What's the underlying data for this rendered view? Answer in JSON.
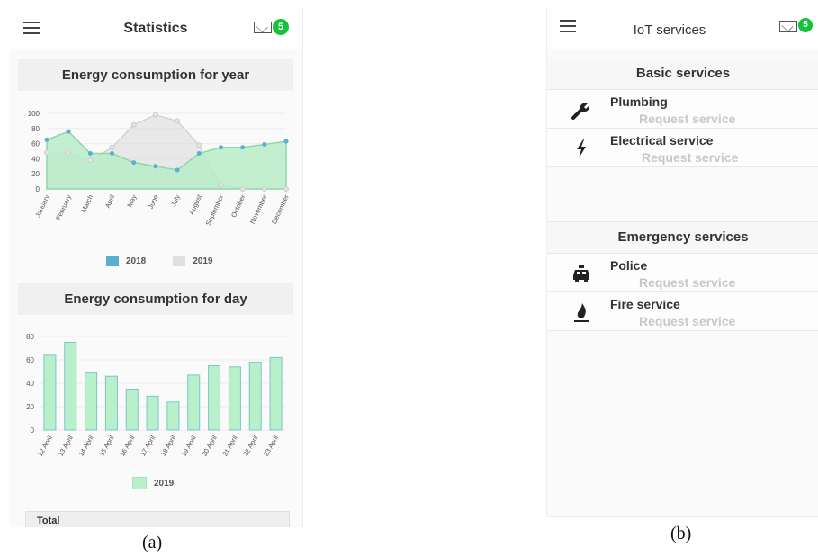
{
  "screen_a": {
    "title": "Statistics",
    "badge_count": "5",
    "year_section": "Energy consumption for year",
    "day_section": "Energy consumption for day",
    "total_label": "Total",
    "caption": "(a)"
  },
  "screen_b": {
    "title": "IoT services",
    "badge_count": "5",
    "basic_header": "Basic services",
    "emergency_header": "Emergency services",
    "basic_items": [
      {
        "name": "Plumbing",
        "action": "Request service",
        "icon": "wrench-icon"
      },
      {
        "name": "Electrical service",
        "action": "Request service",
        "icon": "lightning-icon"
      }
    ],
    "emergency_items": [
      {
        "name": "Police",
        "action": "Request service",
        "icon": "police-car-icon"
      },
      {
        "name": "Fire service",
        "action": "Request service",
        "icon": "fire-icon"
      }
    ],
    "caption": "(b)"
  },
  "colors": {
    "accent_green": "#16c23a",
    "series_2018": "#5aaed0",
    "series_2018_fill": "#b7ecc8",
    "series_2019": "#d9d9d9",
    "bar_fill": "#b7f0c9",
    "bar_stroke": "#7cc4cf"
  },
  "chart_data": [
    {
      "type": "area",
      "categories": [
        "January",
        "February",
        "March",
        "April",
        "May",
        "June",
        "July",
        "August",
        "September",
        "October",
        "November",
        "December"
      ],
      "series": [
        {
          "name": "2018",
          "values": [
            65,
            76,
            47,
            47,
            35,
            30,
            25,
            47,
            55,
            55,
            59,
            63
          ]
        },
        {
          "name": "2019",
          "values": [
            48,
            48,
            38,
            55,
            85,
            98,
            90,
            58,
            5,
            0,
            0,
            0
          ]
        }
      ],
      "yticks": [
        0,
        20,
        40,
        60,
        80,
        100
      ],
      "ylim": [
        0,
        100
      ],
      "legend": "bottom"
    },
    {
      "type": "bar",
      "categories": [
        "12 April",
        "13 April",
        "14 April",
        "15 April",
        "16 April",
        "17 April",
        "18 April",
        "19 April",
        "20 April",
        "21 April",
        "22 April",
        "23 April"
      ],
      "series": [
        {
          "name": "2019",
          "values": [
            64,
            75,
            49,
            46,
            35,
            29,
            24,
            47,
            55,
            54,
            58,
            62
          ]
        }
      ],
      "yticks": [
        0,
        20,
        40,
        60,
        80
      ],
      "ylim": [
        0,
        80
      ],
      "legend": "bottom"
    }
  ]
}
